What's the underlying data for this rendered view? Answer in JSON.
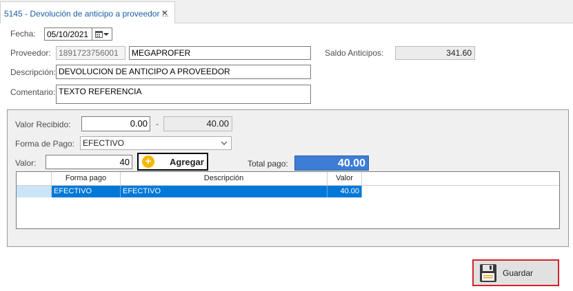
{
  "tab": {
    "title": "5145 - Devolución de anticipo a proveedor ::.",
    "close": "✕"
  },
  "form": {
    "fecha_label": "Fecha:",
    "fecha_value": "05/10/2021",
    "proveedor_label": "Proveedor:",
    "proveedor_id": "1891723756001",
    "proveedor_name": "MEGAPROFER",
    "saldo_label": "Saldo Anticipos:",
    "saldo_value": "341.60",
    "descripcion_label": "Descripción:",
    "descripcion_value": "DEVOLUCION DE ANTICIPO A PROVEEDOR",
    "comentario_label": "Comentario:",
    "comentario_value": "TEXTO REFERENCIA"
  },
  "payment": {
    "valor_recibido_label": "Valor Recibido:",
    "valor_recibido": "0.00",
    "separator": "-",
    "valor_pendiente": "40.00",
    "forma_pago_label": "Forma de Pago:",
    "forma_pago_selected": "EFECTIVO",
    "valor_label": "Valor:",
    "valor_value": "40",
    "agregar_label": "Agregar",
    "total_pago_label": "Total pago:",
    "total_pago_value": "40.00"
  },
  "grid": {
    "columns": [
      "Forma pago",
      "Descripción",
      "Valor"
    ],
    "rows": [
      {
        "forma_pago": "EFECTIVO",
        "descripcion": "EFECTIVO",
        "valor": "40.00"
      }
    ]
  },
  "actions": {
    "guardar_label": "Guardar"
  },
  "colors": {
    "accent": "#0078d7",
    "total_bg": "#3d7dd6",
    "highlight_border": "#d5202a",
    "plus_icon": "#f5b800"
  },
  "icons": [
    "calendar-icon",
    "chevron-down-icon",
    "plus-circle-icon",
    "save-floppy-icon",
    "close-icon"
  ]
}
